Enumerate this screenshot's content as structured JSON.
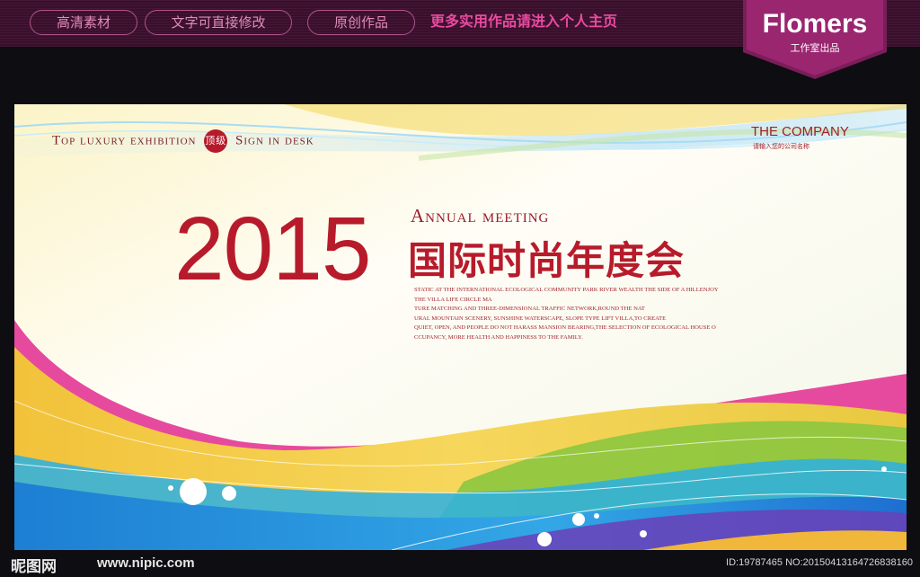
{
  "header": {
    "tags": [
      "高清素材",
      "文字可直接修改",
      "原创作品"
    ],
    "promo": "更多实用作品请进入个人主页",
    "logo_name": "Flomers",
    "logo_sub": "工作室出品"
  },
  "poster": {
    "top_line_left": "Top luxury exhibition",
    "badge": "顶级",
    "top_line_right": "Sign in desk",
    "company": "THE COMPANY",
    "company_sub": "请输入您的公司名称",
    "year": "2015",
    "annual": "Annual meeting",
    "cn_title": "国际时尚年度会",
    "body_lines": [
      "STATIC AT THE INTERNATIONAL ECOLOGICAL COMMUNITY PARK RIVER WEALTH THE SIDE OF A HILLENJOY",
      "THE VILLA LIFE CIRCLE MA",
      "TURE MATCHING AND THREE-DIMENSIONAL TRAFFIC NETWORK,ROUND THE NAT",
      "URAL MOUNTAIN SCENERY, SUNSHINE WATERSCAPE, SLOPE TYPE LIFT VILLA,TO CREATE",
      "QUIET, OPEN, AND PEOPLE DO NOT HARASS MANSION BEARING,THE SELECTION OF ECOLOGICAL HOUSE O",
      "CCUPANCY, MORE HEALTH AND HAPPINESS TO THE FAMILY."
    ]
  },
  "footer": {
    "site_name": "昵图网",
    "site_url": "www.nipic.com",
    "ids": "ID:19787465 NO:20150413164726838160"
  },
  "colors": {
    "accent_red": "#b71b2b",
    "magenta": "#e64a9e",
    "bar_purple": "#3a0f2c"
  }
}
